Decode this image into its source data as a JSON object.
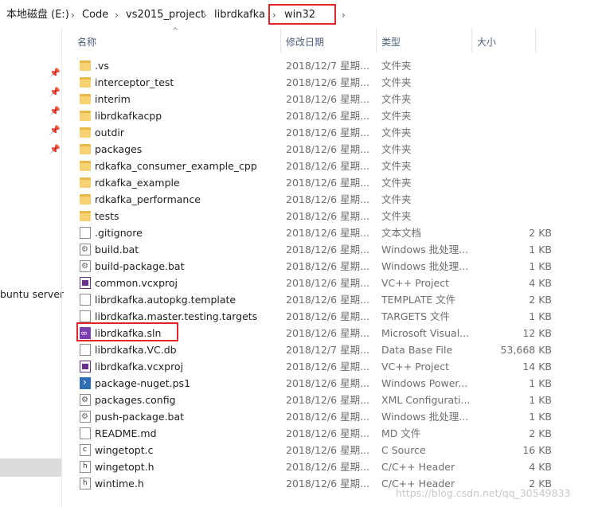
{
  "breadcrumb": {
    "items": [
      "本地磁盘 (E:)",
      "Code",
      "vs2015_project",
      "librdkafka",
      "win32"
    ],
    "separator": "›"
  },
  "nav": {
    "partial_label": "buntu server"
  },
  "columns": {
    "name": "名称",
    "date": "修改日期",
    "type": "类型",
    "size": "大小"
  },
  "files": [
    {
      "name": ".vs",
      "date": "2018/12/7 星期...",
      "type": "文件夹",
      "size": "",
      "icon": "folder-icon"
    },
    {
      "name": "interceptor_test",
      "date": "2018/12/6 星期...",
      "type": "文件夹",
      "size": "",
      "icon": "folder-icon"
    },
    {
      "name": "interim",
      "date": "2018/12/6 星期...",
      "type": "文件夹",
      "size": "",
      "icon": "folder-icon"
    },
    {
      "name": "librdkafkacpp",
      "date": "2018/12/6 星期...",
      "type": "文件夹",
      "size": "",
      "icon": "folder-icon"
    },
    {
      "name": "outdir",
      "date": "2018/12/6 星期...",
      "type": "文件夹",
      "size": "",
      "icon": "folder-icon"
    },
    {
      "name": "packages",
      "date": "2018/12/6 星期...",
      "type": "文件夹",
      "size": "",
      "icon": "folder-icon"
    },
    {
      "name": "rdkafka_consumer_example_cpp",
      "date": "2018/12/6 星期...",
      "type": "文件夹",
      "size": "",
      "icon": "folder-icon"
    },
    {
      "name": "rdkafka_example",
      "date": "2018/12/6 星期...",
      "type": "文件夹",
      "size": "",
      "icon": "folder-icon"
    },
    {
      "name": "rdkafka_performance",
      "date": "2018/12/6 星期...",
      "type": "文件夹",
      "size": "",
      "icon": "folder-icon"
    },
    {
      "name": "tests",
      "date": "2018/12/6 星期...",
      "type": "文件夹",
      "size": "",
      "icon": "folder-icon"
    },
    {
      "name": ".gitignore",
      "date": "2018/12/6 星期...",
      "type": "文本文档",
      "size": "2 KB",
      "icon": "text-file-icon"
    },
    {
      "name": "build.bat",
      "date": "2018/12/6 星期...",
      "type": "Windows 批处理...",
      "size": "1 KB",
      "icon": "batch-file-icon"
    },
    {
      "name": "build-package.bat",
      "date": "2018/12/6 星期...",
      "type": "Windows 批处理...",
      "size": "1 KB",
      "icon": "batch-file-icon"
    },
    {
      "name": "common.vcxproj",
      "date": "2018/12/6 星期...",
      "type": "VC++ Project",
      "size": "4 KB",
      "icon": "vcxproj-icon"
    },
    {
      "name": "librdkafka.autopkg.template",
      "date": "2018/12/6 星期...",
      "type": "TEMPLATE 文件",
      "size": "2 KB",
      "icon": "file-icon"
    },
    {
      "name": "librdkafka.master.testing.targets",
      "date": "2018/12/6 星期...",
      "type": "TARGETS 文件",
      "size": "1 KB",
      "icon": "file-icon"
    },
    {
      "name": "librdkafka.sln",
      "date": "2018/12/6 星期...",
      "type": "Microsoft Visual...",
      "size": "12 KB",
      "icon": "visual-studio-solution-icon"
    },
    {
      "name": "librdkafka.VC.db",
      "date": "2018/12/7 星期...",
      "type": "Data Base File",
      "size": "53,668 KB",
      "icon": "file-icon"
    },
    {
      "name": "librdkafka.vcxproj",
      "date": "2018/12/6 星期...",
      "type": "VC++ Project",
      "size": "14 KB",
      "icon": "vcxproj-icon"
    },
    {
      "name": "package-nuget.ps1",
      "date": "2018/12/6 星期...",
      "type": "Windows Power...",
      "size": "1 KB",
      "icon": "powershell-icon"
    },
    {
      "name": "packages.config",
      "date": "2018/12/6 星期...",
      "type": "XML Configurati...",
      "size": "1 KB",
      "icon": "config-file-icon"
    },
    {
      "name": "push-package.bat",
      "date": "2018/12/6 星期...",
      "type": "Windows 批处理...",
      "size": "1 KB",
      "icon": "batch-file-icon"
    },
    {
      "name": "README.md",
      "date": "2018/12/6 星期...",
      "type": "MD 文件",
      "size": "2 KB",
      "icon": "file-icon"
    },
    {
      "name": "wingetopt.c",
      "date": "2018/12/6 星期...",
      "type": "C Source",
      "size": "16 KB",
      "icon": "c-source-icon"
    },
    {
      "name": "wingetopt.h",
      "date": "2018/12/6 星期...",
      "type": "C/C++ Header",
      "size": "4 KB",
      "icon": "header-file-icon"
    },
    {
      "name": "wintime.h",
      "date": "2018/12/6 星期...",
      "type": "C/C++ Header",
      "size": "2 KB",
      "icon": "header-file-icon"
    }
  ],
  "watermark": "https://blog.csdn.net/qq_30549833",
  "colors": {
    "highlight_box": "#e0242a",
    "header_text": "#4c607a",
    "folder": "#f7d272"
  }
}
